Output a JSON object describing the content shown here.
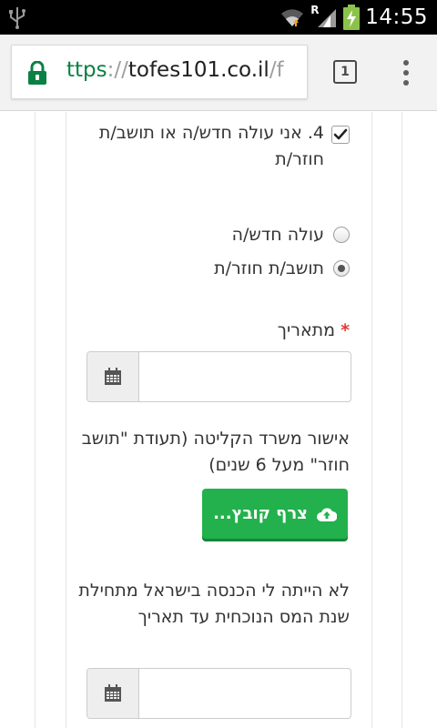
{
  "status_bar": {
    "time": "14:55",
    "network_letter": "R"
  },
  "browser": {
    "url_scheme": "ttps",
    "url_sep": "://",
    "url_host": "tofes101.co.il",
    "url_path": "/f",
    "tab_count": "1"
  },
  "form": {
    "question": "4. אני עולה חדש/ה או תושב/ת חוזר/ת",
    "question_checked": true,
    "radio_options": [
      {
        "label": "עולה חדש/ה",
        "selected": false
      },
      {
        "label": "תושב/ת חוזר/ת",
        "selected": true
      }
    ],
    "from_date": {
      "label": "מתאריך",
      "required_mark": "*",
      "value": ""
    },
    "upload": {
      "label": "אישור משרד הקליטה (תעודת \"תושב חוזר\" מעל 6 שנים)",
      "button_label": "צרף קובץ..."
    },
    "no_income": {
      "label": "לא הייתה לי הכנסה בישראל מתחילת שנת המס הנוכחית עד תאריך",
      "value": ""
    }
  },
  "colors": {
    "upload_button": "#22b14c",
    "required_star": "#e53935",
    "secure_scheme": "#0b8043"
  },
  "icons": {
    "usb": "usb-icon",
    "wifi": "wifi-icon",
    "signal": "signal-icon",
    "battery": "battery-charging-icon",
    "lock": "lock-icon",
    "tabs": "tabs-icon",
    "menu": "overflow-menu-icon",
    "checkbox": "checkmark-icon",
    "calendar": "calendar-icon",
    "upload": "cloud-upload-icon"
  }
}
